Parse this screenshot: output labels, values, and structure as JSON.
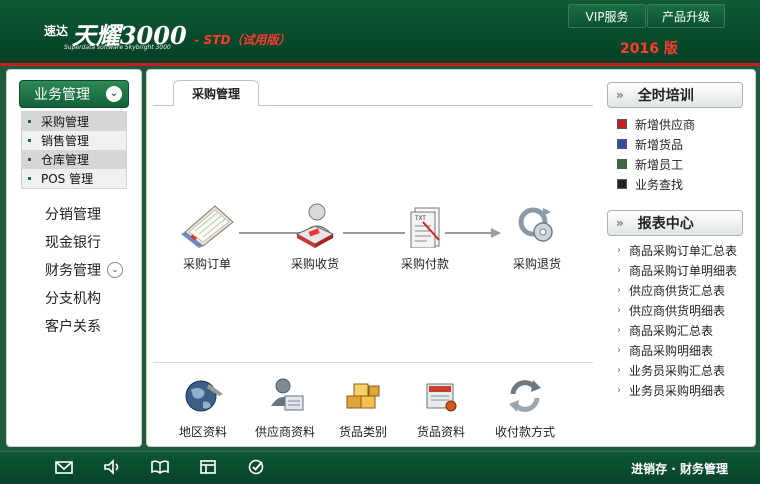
{
  "header": {
    "logo_prefix": "速达",
    "logo_brand": "天耀3000",
    "logo_subtitle": "Superdata software Skybright 3000",
    "logo_edition": "- STD（试用版）",
    "buttons": [
      "VIP服务",
      "产品升级"
    ],
    "year": "2016 版"
  },
  "sidebar": {
    "header": "业务管理",
    "sub_items": [
      "采购管理",
      "销售管理",
      "仓库管理",
      "POS 管理"
    ],
    "items": [
      "分销管理",
      "现金银行",
      "财务管理",
      "分支机构",
      "客户关系"
    ]
  },
  "main": {
    "tab": "采购管理",
    "flow": [
      "采购订单",
      "采购收货",
      "采购付款",
      "采购退货"
    ],
    "base": [
      "地区资料",
      "供应商资料",
      "货品类别",
      "货品资料",
      "收付款方式"
    ]
  },
  "training": {
    "title": "全时培训",
    "items": [
      "新增供应商",
      "新增货品",
      "新增员工",
      "业务查找"
    ],
    "colors": [
      "#c0202a",
      "#2a4fa8",
      "#3d6b3a",
      "#222222"
    ]
  },
  "reports": {
    "title": "报表中心",
    "items": [
      "商品采购订单汇总表",
      "商品采购订单明细表",
      "供应商供货汇总表",
      "供应商供货明细表",
      "商品采购汇总表",
      "商品采购明细表",
      "业务员采购汇总表",
      "业务员采购明细表"
    ]
  },
  "footer": {
    "text": "进销存 · 财务管理",
    "icons": [
      "mail-icon",
      "speaker-icon",
      "book-icon",
      "window-icon",
      "check-icon"
    ]
  }
}
